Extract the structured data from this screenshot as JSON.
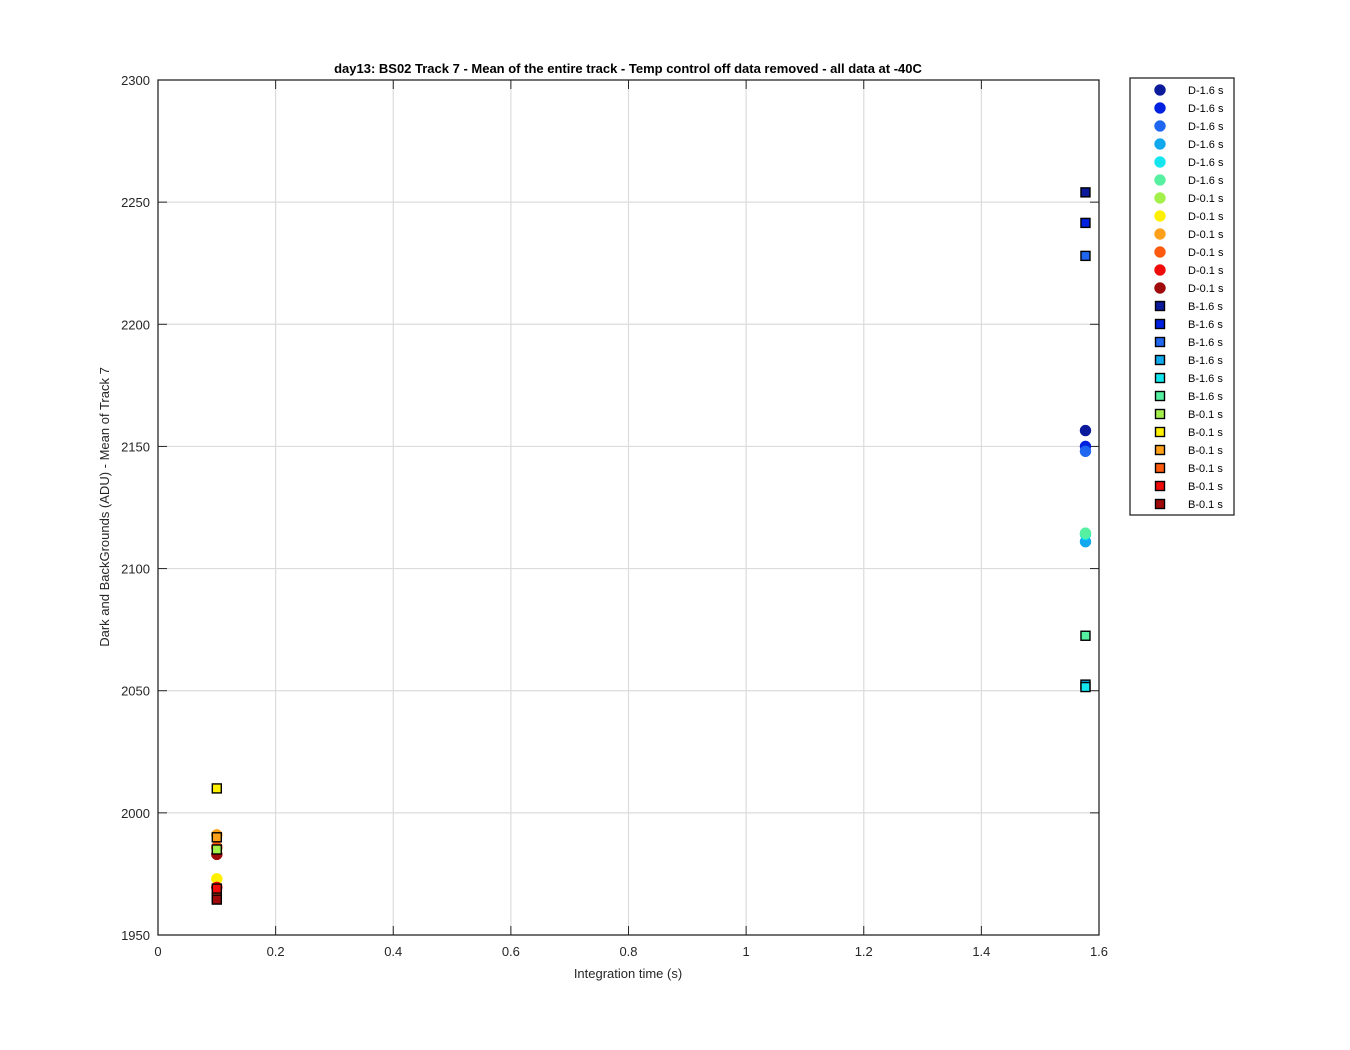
{
  "chart_data": {
    "type": "scatter",
    "title": "day13: BS02  Track 7 - Mean of the entire track - Temp control off data removed - all data at -40C",
    "xlabel": "Integration time (s)",
    "ylabel": "Dark and BackGrounds (ADU) - Mean of Track 7",
    "xlim": [
      0,
      1.6
    ],
    "ylim": [
      1950,
      2300
    ],
    "x_ticks": [
      0,
      0.2,
      0.4,
      0.6,
      0.8,
      1,
      1.2,
      1.4,
      1.6
    ],
    "x_tick_labels": [
      "0",
      "0.2",
      "0.4",
      "0.6",
      "0.8",
      "1",
      "1.2",
      "1.4",
      "1.6"
    ],
    "y_ticks": [
      1950,
      2000,
      2050,
      2100,
      2150,
      2200,
      2250,
      2300
    ],
    "y_tick_labels": [
      "1950",
      "2000",
      "2050",
      "2100",
      "2150",
      "2200",
      "2250",
      "2300"
    ],
    "grid": true,
    "legend_position": "outside-top-right",
    "series": [
      {
        "name": "D-1.6 s",
        "marker": "circle",
        "color": "#0a1a9a",
        "points": [
          [
            1.577,
            2156.5
          ]
        ]
      },
      {
        "name": "D-1.6 s",
        "marker": "circle",
        "color": "#0022e0",
        "points": [
          [
            1.577,
            2150.0
          ]
        ]
      },
      {
        "name": "D-1.6 s",
        "marker": "circle",
        "color": "#1f66f0",
        "points": [
          [
            1.577,
            2148.0
          ]
        ]
      },
      {
        "name": "D-1.6 s",
        "marker": "circle",
        "color": "#10a8ee",
        "points": [
          [
            1.577,
            2111.0
          ]
        ]
      },
      {
        "name": "D-1.6 s",
        "marker": "circle",
        "color": "#14e6f0",
        "points": [
          [
            1.577,
            2114.0
          ]
        ]
      },
      {
        "name": "D-1.6 s",
        "marker": "circle",
        "color": "#55f0a0",
        "points": [
          [
            1.577,
            2114.5
          ]
        ]
      },
      {
        "name": "D-0.1 s",
        "marker": "circle",
        "color": "#a4f04a",
        "points": [
          [
            0.1,
            1985.5
          ]
        ]
      },
      {
        "name": "D-0.1 s",
        "marker": "circle",
        "color": "#fff000",
        "points": [
          [
            0.1,
            1973.0
          ]
        ]
      },
      {
        "name": "D-0.1 s",
        "marker": "circle",
        "color": "#ffa01a",
        "points": [
          [
            0.1,
            1991.0
          ]
        ]
      },
      {
        "name": "D-0.1 s",
        "marker": "circle",
        "color": "#ff5a10",
        "points": [
          [
            0.1,
            1986.0
          ]
        ]
      },
      {
        "name": "D-0.1 s",
        "marker": "circle",
        "color": "#f00a0a",
        "points": [
          [
            0.1,
            1969.5
          ]
        ]
      },
      {
        "name": "D-0.1 s",
        "marker": "circle",
        "color": "#a00a0a",
        "points": [
          [
            0.1,
            1983.0
          ]
        ]
      },
      {
        "name": "B-1.6 s",
        "marker": "square",
        "color": "#0a1a9a",
        "points": [
          [
            1.577,
            2254.0
          ]
        ]
      },
      {
        "name": "B-1.6 s",
        "marker": "square",
        "color": "#0022e0",
        "points": [
          [
            1.577,
            2241.5
          ]
        ]
      },
      {
        "name": "B-1.6 s",
        "marker": "square",
        "color": "#1f66f0",
        "points": [
          [
            1.577,
            2228.0
          ]
        ]
      },
      {
        "name": "B-1.6 s",
        "marker": "square",
        "color": "#10a8ee",
        "points": [
          [
            1.577,
            2052.5
          ]
        ]
      },
      {
        "name": "B-1.6 s",
        "marker": "square",
        "color": "#14e6f0",
        "points": [
          [
            1.577,
            2051.5
          ]
        ]
      },
      {
        "name": "B-1.6 s",
        "marker": "square",
        "color": "#55f0a0",
        "points": [
          [
            1.577,
            2072.5
          ]
        ]
      },
      {
        "name": "B-0.1 s",
        "marker": "square",
        "color": "#a4f04a",
        "points": [
          [
            0.1,
            1985.0
          ]
        ]
      },
      {
        "name": "B-0.1 s",
        "marker": "square",
        "color": "#fff000",
        "points": [
          [
            0.1,
            2010.0
          ]
        ]
      },
      {
        "name": "B-0.1 s",
        "marker": "square",
        "color": "#ffa01a",
        "points": [
          [
            0.1,
            1990.0
          ]
        ]
      },
      {
        "name": "B-0.1 s",
        "marker": "square",
        "color": "#ff5a10",
        "points": [
          [
            0.1,
            1965.5
          ]
        ]
      },
      {
        "name": "B-0.1 s",
        "marker": "square",
        "color": "#f00a0a",
        "points": [
          [
            0.1,
            1969.0
          ]
        ]
      },
      {
        "name": "B-0.1 s",
        "marker": "square",
        "color": "#a00a0a",
        "points": [
          [
            0.1,
            1964.5
          ]
        ]
      }
    ]
  }
}
